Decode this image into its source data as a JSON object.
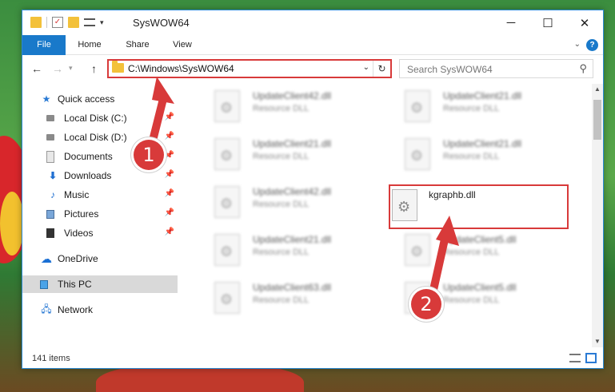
{
  "titlebar": {
    "title": "SysWOW64",
    "min_glyph": "─",
    "max_glyph": "☐",
    "close_glyph": "✕"
  },
  "ribbon": {
    "tabs": [
      "File",
      "Home",
      "Share",
      "View"
    ],
    "help": "?"
  },
  "nav": {
    "back": "←",
    "forward": "→",
    "up": "↑"
  },
  "address": {
    "path": "C:\\Windows\\SysWOW64",
    "refresh": "↻"
  },
  "search": {
    "placeholder": "Search SysWOW64"
  },
  "navpane": {
    "items": [
      {
        "label": "Quick access",
        "icon": "star-icon"
      },
      {
        "label": "Local Disk (C:)",
        "icon": "drive-icon"
      },
      {
        "label": "Local Disk (D:)",
        "icon": "drive-icon"
      },
      {
        "label": "Documents",
        "icon": "documents-icon"
      },
      {
        "label": "Downloads",
        "icon": "downloads-icon"
      },
      {
        "label": "Music",
        "icon": "music-icon"
      },
      {
        "label": "Pictures",
        "icon": "pictures-icon"
      },
      {
        "label": "Videos",
        "icon": "videos-icon"
      },
      {
        "label": "OneDrive",
        "icon": "cloud-icon"
      },
      {
        "label": "This PC",
        "icon": "computer-icon"
      },
      {
        "label": "Network",
        "icon": "network-icon"
      }
    ]
  },
  "files": [
    {
      "name": "UpdateClient42.dll",
      "type": "Resource DLL"
    },
    {
      "name": "UpdateClient21.dll",
      "type": "Resource DLL"
    },
    {
      "name": "UpdateClient21.dll",
      "type": "Resource DLL"
    },
    {
      "name": "UpdateClient21.dll",
      "type": "Resource DLL"
    },
    {
      "name": "UpdateClient42.dll",
      "type": "Resource DLL"
    },
    {
      "name": "kgraphb.dll",
      "type": ""
    },
    {
      "name": "UpdateClient21.dll",
      "type": "Resource DLL"
    },
    {
      "name": "UpdateClient5.dll",
      "type": "Resource DLL"
    },
    {
      "name": "UpdateClient63.dll",
      "type": "Resource DLL"
    },
    {
      "name": "UpdateClient5.dll",
      "type": "Resource DLL"
    }
  ],
  "status": {
    "count": "141 items"
  },
  "callouts": [
    "1",
    "2"
  ],
  "colors": {
    "accent": "#1979ca",
    "highlight": "#d83a3a"
  }
}
